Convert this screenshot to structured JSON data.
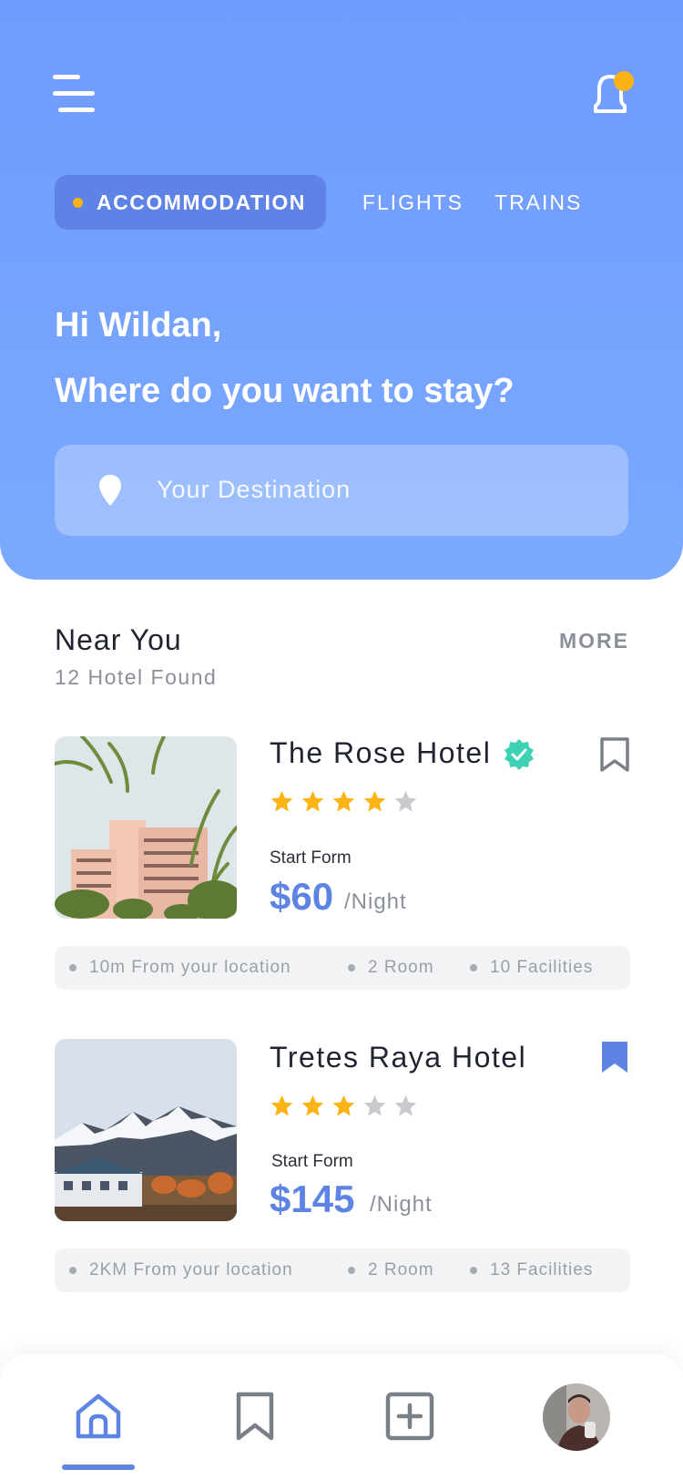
{
  "header": {
    "tabs": [
      {
        "label": "ACCOMMODATION",
        "active": true
      },
      {
        "label": "FLIGHTS",
        "active": false
      },
      {
        "label": "TRAINS",
        "active": false
      }
    ],
    "greeting": "Hi Wildan,",
    "question": "Where do you want to stay?",
    "search": {
      "placeholder": "Your Destination"
    },
    "icons": {
      "menu": "hamburger-menu-icon",
      "notification": "bell-icon",
      "location": "map-pin-icon"
    }
  },
  "section": {
    "title": "Near You",
    "subtitle": "12 Hotel Found",
    "more_label": "MORE"
  },
  "hotels": [
    {
      "name": "The Rose Hotel",
      "verified": true,
      "bookmarked": false,
      "rating": 4,
      "max_rating": 5,
      "price_label": "Start Form",
      "price": "$60",
      "per_night": "/Night",
      "info": [
        "10m From  your location",
        "2 Room",
        "10 Facilities"
      ]
    },
    {
      "name": "Tretes Raya Hotel",
      "verified": false,
      "bookmarked": true,
      "rating": 3,
      "max_rating": 5,
      "price_label": "Start Form",
      "price": "$145",
      "per_night": "/Night",
      "info": [
        "2KM From  your location",
        "2 Room",
        "13 Facilities"
      ]
    }
  ],
  "bottom_nav": {
    "items": [
      "home-icon",
      "bookmark-icon",
      "add-square-icon",
      "profile-avatar"
    ],
    "active": "home-icon"
  },
  "colors": {
    "header_bg": "#6f9bff",
    "active_tab_bg": "#5f82e6",
    "accent": "#5e84e3",
    "star_filled": "#fbb315",
    "star_empty": "#c8cace",
    "verified": "#3ed1b4"
  }
}
